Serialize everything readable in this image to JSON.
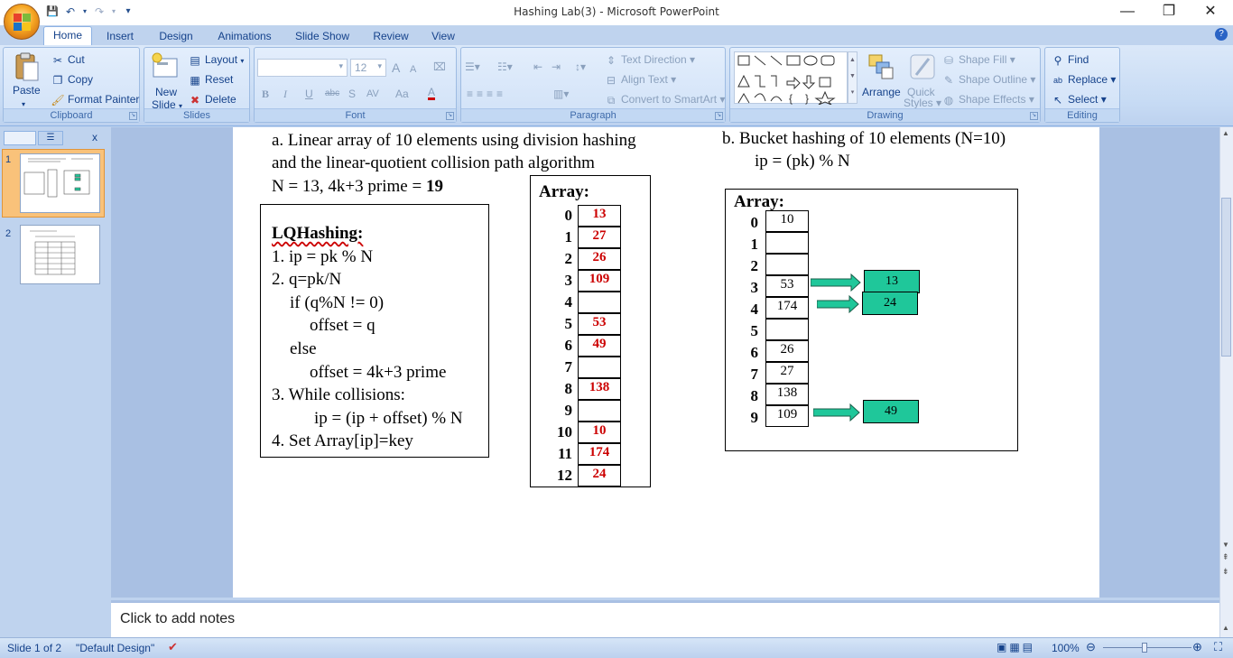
{
  "window": {
    "title": "Hashing Lab(3) - Microsoft PowerPoint",
    "minimize": "—",
    "restore": "❐",
    "close": "✕"
  },
  "qat": {
    "save": "💾",
    "undo": "↶",
    "redo": "↷",
    "customize": "▾"
  },
  "tabs": [
    {
      "label": "Home"
    },
    {
      "label": "Insert"
    },
    {
      "label": "Design"
    },
    {
      "label": "Animations"
    },
    {
      "label": "Slide Show"
    },
    {
      "label": "Review"
    },
    {
      "label": "View"
    }
  ],
  "ribbon": {
    "clipboard": {
      "title": "Clipboard",
      "paste": "Paste",
      "cut": "Cut",
      "copy": "Copy",
      "format_painter": "Format Painter"
    },
    "slides": {
      "title": "Slides",
      "new_slide": "New",
      "new_slide2": "Slide",
      "layout": "Layout",
      "reset": "Reset",
      "delete": "Delete"
    },
    "font": {
      "title": "Font",
      "font_size": "12",
      "bold": "B",
      "italic": "I",
      "underline": "U",
      "strike": "abc",
      "shadow": "S",
      "spacing": "AV",
      "case": "Aa",
      "color": "A",
      "grow": "A",
      "shrink": "A"
    },
    "paragraph": {
      "title": "Paragraph",
      "text_direction": "Text Direction",
      "align_text": "Align Text",
      "smartart": "Convert to SmartArt"
    },
    "drawing": {
      "title": "Drawing",
      "arrange": "Arrange",
      "quick_styles": "Quick",
      "quick_styles2": "Styles",
      "shape_fill": "Shape Fill",
      "shape_outline": "Shape Outline",
      "shape_effects": "Shape Effects"
    },
    "editing": {
      "title": "Editing",
      "find": "Find",
      "replace": "Replace",
      "select": "Select"
    }
  },
  "slides_panel": {
    "thumb1_num": "1",
    "thumb2_num": "2",
    "close": "x"
  },
  "slide": {
    "part_a_line1": "a.    Linear array of 10 elements  using division hashing",
    "part_a_line2": "and the linear-quotient collision path algorithm",
    "part_a_line3_pre": "N = 13, 4k+3 prime = ",
    "part_a_line3_bold": "19",
    "part_b_line1": "b.    Bucket hashing of 10 elements  (N=10)",
    "part_b_line2": "ip = (pk) % N",
    "lq": {
      "title": "LQHashing:",
      "lines": [
        "1. ip = pk % N",
        "2. q=pk/N",
        "if (q%N != 0)",
        "offset = q",
        "else",
        "offset = 4k+3 prime",
        "3. While collisions:",
        "ip = (ip + offset) % N",
        "4. Set Array[ip]=key"
      ]
    },
    "array_a": {
      "title": "Array:",
      "indices": [
        "0",
        "1",
        "2",
        "3",
        "4",
        "5",
        "6",
        "7",
        "8",
        "9",
        "10",
        "11",
        "12"
      ],
      "values": [
        "13",
        "27",
        "26",
        "109",
        "",
        "53",
        "49",
        "",
        "138",
        "",
        "10",
        "174",
        "24"
      ]
    },
    "array_b": {
      "title": "Array:",
      "indices": [
        "0",
        "1",
        "2",
        "3",
        "4",
        "5",
        "6",
        "7",
        "8",
        "9"
      ],
      "values": [
        "10",
        "",
        "",
        "53",
        "174",
        "",
        "26",
        "27",
        "138",
        "109"
      ],
      "overflow": [
        {
          "label": "13"
        },
        {
          "label": "24"
        },
        {
          "label": "49"
        }
      ],
      "overflow_color": "#1fc79a"
    },
    "red_color": "#cc0000"
  },
  "notes": {
    "placeholder": "Click to add notes"
  },
  "status": {
    "slide_of": "Slide 1 of 2",
    "theme": "\"Default Design\"",
    "zoom": "100%"
  }
}
